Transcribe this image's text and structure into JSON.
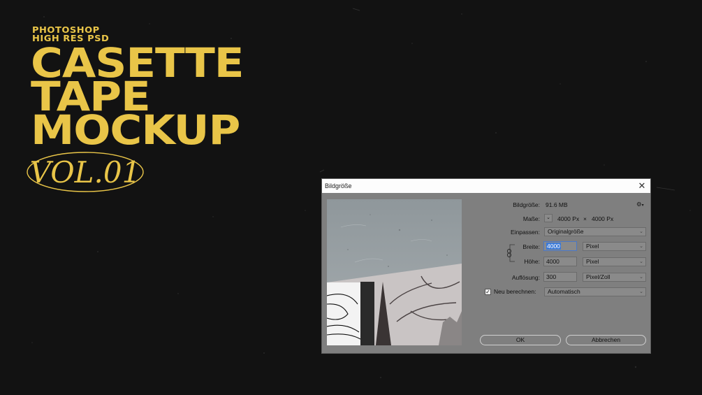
{
  "poster": {
    "eyebrow": [
      "PHOTOSHOP",
      "HIGH RES PSD"
    ],
    "title_lines": [
      "CASETTE",
      "TAPE",
      "MOCKUP"
    ],
    "badge": "VOL.01",
    "accent_color": "#e9c548"
  },
  "dialog": {
    "title": "Bildgröße",
    "close_icon": "close-icon",
    "size": {
      "label": "Bildgröße:",
      "value": "91.6 MB"
    },
    "settings_icon": "gear-icon",
    "dimensions": {
      "label": "Maße:",
      "width": "4000 Px",
      "sep": "×",
      "height": "4000 Px"
    },
    "fit": {
      "label": "Einpassen:",
      "value": "Originalgröße"
    },
    "width": {
      "label": "Breite:",
      "value": "4000",
      "unit": "Pixel"
    },
    "height": {
      "label": "Höhe:",
      "value": "4000",
      "unit": "Pixel"
    },
    "resolution": {
      "label": "Auflösung:",
      "value": "300",
      "unit": "Pixel/Zoll"
    },
    "resample": {
      "label": "Neu berechnen:",
      "checked": true,
      "value": "Automatisch"
    },
    "ok_label": "OK",
    "cancel_label": "Abbrechen"
  }
}
